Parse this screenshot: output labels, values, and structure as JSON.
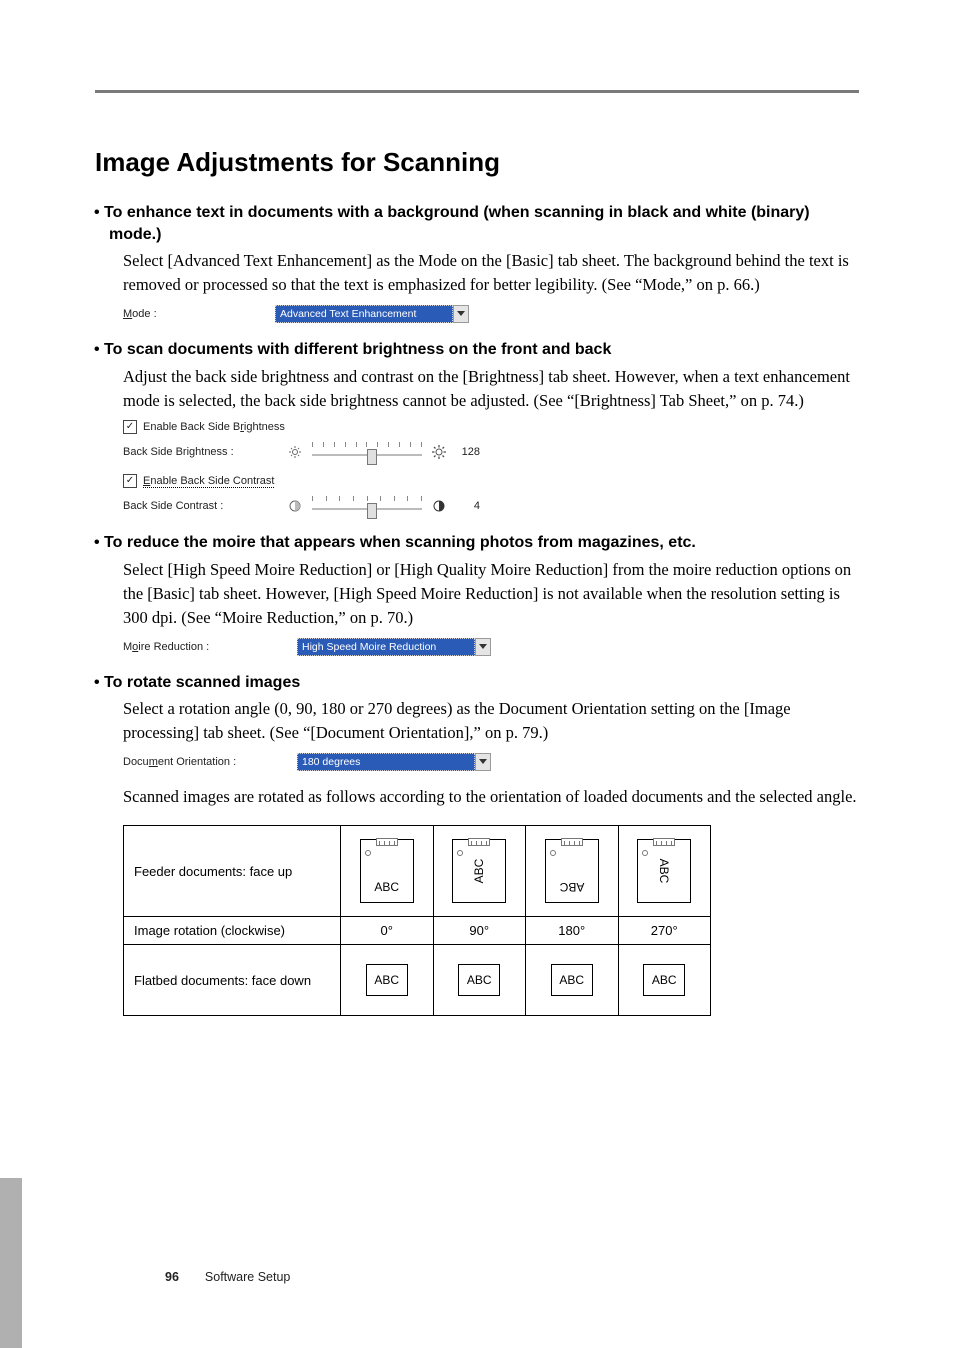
{
  "page": {
    "number": "96",
    "section": "Software Setup"
  },
  "title": "Image Adjustments for Scanning",
  "items": [
    {
      "heading": "To enhance text in documents with a background (when scanning in black and white (binary) mode.)",
      "body": "Select [Advanced Text Enhancement] as the Mode on the [Basic] tab sheet. The background behind the text is removed or processed so that the text is emphasized for better legibility. (See “Mode,” on p. 66.)"
    },
    {
      "heading": "To scan documents with different brightness on the front and back",
      "body": "Adjust the back side brightness and contrast on the [Brightness] tab sheet. However, when a text enhancement mode is selected, the back side brightness cannot be adjusted. (See “[Brightness] Tab Sheet,” on p. 74.)"
    },
    {
      "heading": "To reduce the moire that appears when scanning photos from magazines, etc.",
      "body": "Select [High Speed Moire Reduction] or [High Quality Moire Reduction] from the moire reduction options on the [Basic] tab sheet. However, [High Speed Moire Reduction] is not available when the resolution setting is 300 dpi. (See “Moire Reduction,” on p. 70.)"
    },
    {
      "heading": "To rotate scanned images",
      "body": "Select a rotation angle (0, 90, 180 or 270 degrees) as the Document Orientation setting on the [Image processing] tab sheet. (See “[Document Orientation],” on p. 79.)",
      "body2": "Scanned images are rotated as follows according to the orientation of loaded documents and the selected angle."
    }
  ],
  "ui": {
    "mode": {
      "label_pre": "M",
      "label_post": "ode :",
      "value": "Advanced Text Enhancement"
    },
    "brightness": {
      "chk1_pre": "Enable Back Side B",
      "chk1_u": "r",
      "chk1_post": "ightness",
      "row1_label": "Back Side Brightness :",
      "row1_value": "128",
      "chk2_pre": "E",
      "chk2_post": "nable Back Side Contrast",
      "row2_label": "Back Side Contrast :",
      "row2_value": "4"
    },
    "moire": {
      "label_pre": "M",
      "label_u": "o",
      "label_post": "ire Reduction :",
      "value": "High Speed Moire Reduction"
    },
    "orientation": {
      "label_pre": "Docu",
      "label_u": "m",
      "label_post": "ent Orientation :",
      "value": "180 degrees"
    }
  },
  "table": {
    "row1_label": "Feeder documents: face up",
    "row2_label": "Image rotation (clockwise)",
    "row3_label": "Flatbed documents: face down",
    "angles": [
      "0°",
      "90°",
      "180°",
      "270°"
    ],
    "doc_text": "ABC",
    "flat_text": "ABC"
  }
}
